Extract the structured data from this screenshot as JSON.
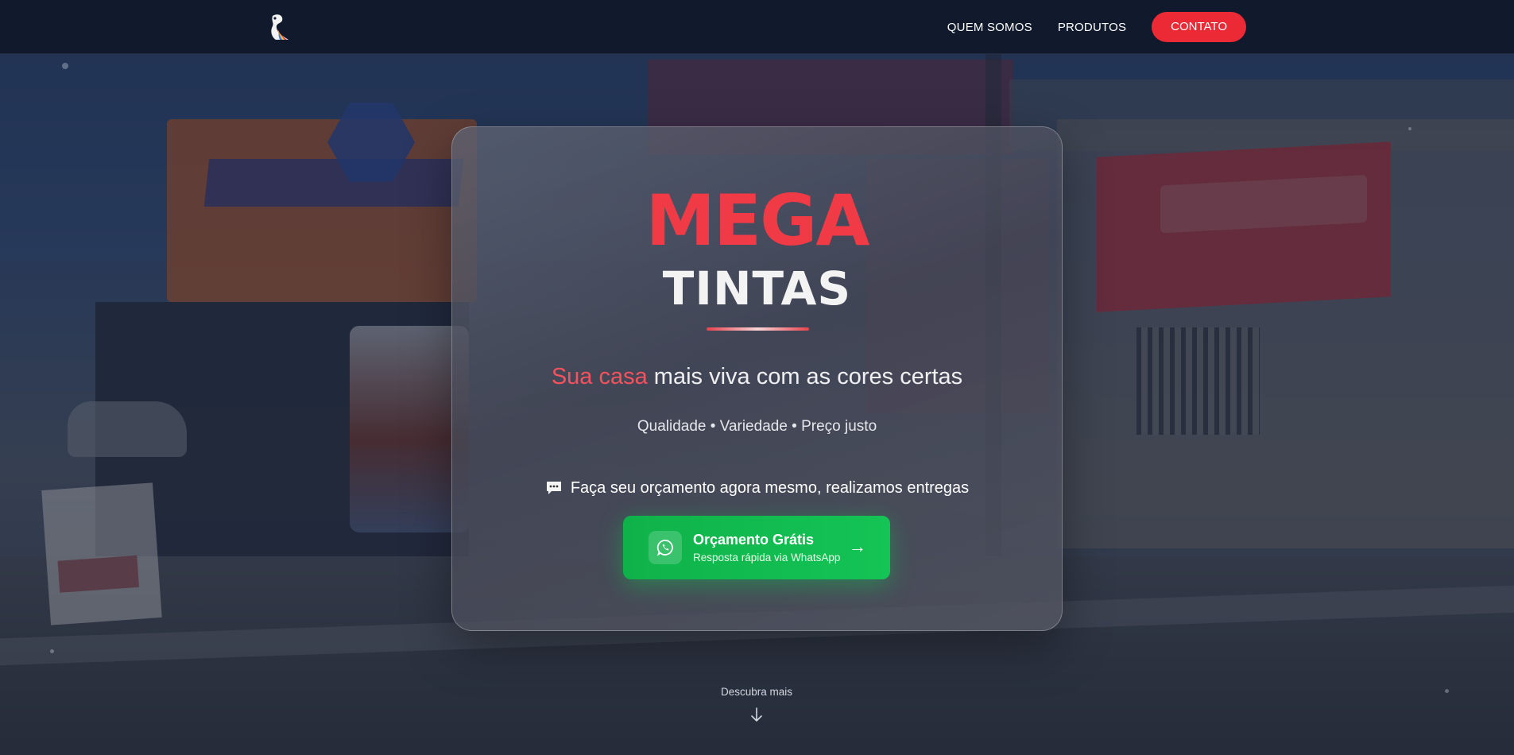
{
  "header": {
    "logo_icon": "brand-logo-icon",
    "nav": [
      {
        "label": "QUEM SOMOS"
      },
      {
        "label": "PRODUTOS"
      }
    ],
    "cta_label": "CONTATO"
  },
  "hero": {
    "brand_primary": "MEGA",
    "brand_secondary": "TINTAS",
    "tagline_accent": "Sua casa",
    "tagline_rest": " mais viva com as cores certas",
    "subline": "Qualidade • Variedade • Preço justo",
    "quote_text": "Faça seu orçamento agora mesmo, realizamos entregas",
    "quote_icon": "speech-bubble-icon",
    "button": {
      "title": "Orçamento Grátis",
      "subtitle": "Resposta rápida via WhatsApp",
      "icon": "whatsapp-icon",
      "arrow": "→"
    }
  },
  "scroll_hint": {
    "label": "Descubra mais",
    "icon": "arrow-down-icon"
  },
  "colors": {
    "header_bg": "#111a2c",
    "accent_red": "#ec2a35",
    "whatsapp_green": "#14c455"
  }
}
